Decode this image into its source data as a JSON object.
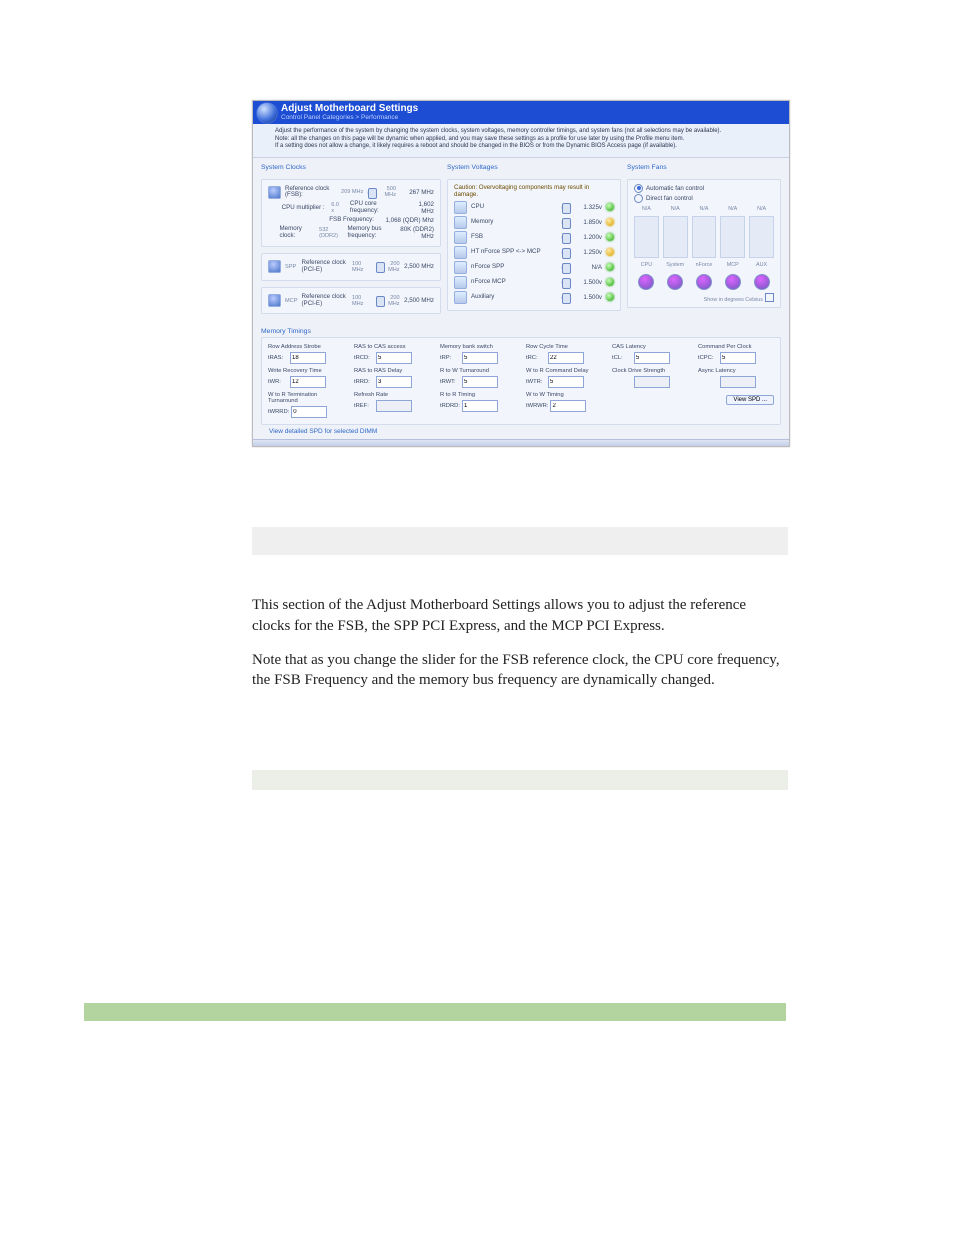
{
  "screenshot": {
    "title": "Adjust Motherboard Settings",
    "breadcrumb": "Control Panel Categories  >  Performance",
    "desc_line1": "Adjust the performance of the system by changing the system clocks, system voltages, memory controller timings, and system fans (not all selections may be available).",
    "desc_line2": "Note: all the changes on this page will be dynamic when applied, and you may save these settings as a profile for use later by using the Profile menu item.",
    "desc_line3": "If a setting does not allow a change, it likely requires a reboot and should be changed in the BIOS or from the Dynamic BIOS Access page (if available).",
    "clocks": {
      "heading": "System Clocks",
      "ref_fsb_label": "Reference clock (FSB):",
      "ref_fsb_val": "209\nMHz",
      "ref_fsb_max": "500\nMHz",
      "ref_fsb_mhz": "267 MHz",
      "cpu_mult_label": "CPU multiplier :",
      "cpu_mult_val": "6.0 x",
      "cpu_core_label": "CPU core frequency:",
      "cpu_core_val": "1,602 MHz",
      "fsb_freq_label": "FSB Frequency:",
      "fsb_freq_val": "1,068 (QDR) Mhz",
      "mem_clk_label": "Memory clock:",
      "mem_clk_val": "532 (DDR2)",
      "mem_bus_label": "Memory bus frequency:",
      "mem_bus_val": "80K (DDR2) MHz",
      "spp_label": "Reference clock (PCI-E)",
      "spp_tag": "SPP",
      "spp_val": "100\nMHz",
      "spp_max": "200\nMHz",
      "spp_mhz": "2,500 MHz",
      "mcp_label": "Reference clock (PCI-E)",
      "mcp_tag": "MCP",
      "mcp_val": "100\nMHz",
      "mcp_max": "200\nMHz",
      "mcp_mhz": "2,500 MHz"
    },
    "voltages": {
      "heading": "System Voltages",
      "caution": "Caution: Overvoltaging components may result in damage.",
      "items": [
        {
          "name": "CPU",
          "val": "1.325v",
          "led": "g"
        },
        {
          "name": "Memory",
          "val": "1.850v",
          "led": "y"
        },
        {
          "name": "FSB",
          "val": "1.200v",
          "led": "g"
        },
        {
          "name": "HT nForce SPP <-> MCP",
          "val": "1.250v",
          "led": "y"
        },
        {
          "name": "nForce SPP",
          "val": "N/A",
          "led": "g"
        },
        {
          "name": "nForce MCP",
          "val": "1.500v",
          "led": "g"
        },
        {
          "name": "Auxiliary",
          "val": "1.500v",
          "led": "g"
        }
      ]
    },
    "fans": {
      "heading": "System Fans",
      "opt_auto": "Automatic fan control",
      "opt_direct": "Direct fan control",
      "cols": [
        "CPU",
        "System",
        "nForce",
        "MCP",
        "AUX"
      ],
      "na": "N/A",
      "foot": "Show in degrees Celsius"
    },
    "timings": {
      "heading": "Memory Timings",
      "cells": [
        {
          "title": "Row Address Strobe",
          "abbr": "tRAS:",
          "val": "18"
        },
        {
          "title": "RAS to CAS access",
          "abbr": "tRCD:",
          "val": "5"
        },
        {
          "title": "Memory bank switch",
          "abbr": "tRP:",
          "val": "5"
        },
        {
          "title": "Row Cycle Time",
          "abbr": "tRC:",
          "val": "22"
        },
        {
          "title": "CAS Latency",
          "abbr": "tCL:",
          "val": "5"
        },
        {
          "title": "Command Per Clock",
          "abbr": "tCPC:",
          "val": "5"
        },
        {
          "title": "Write Recovery Time",
          "abbr": "tWR:",
          "val": "12"
        },
        {
          "title": "RAS to RAS Delay",
          "abbr": "tRRD:",
          "val": "3"
        },
        {
          "title": "R to W Turnaround",
          "abbr": "tRWT:",
          "val": "5"
        },
        {
          "title": "W to R Command Delay",
          "abbr": "tWTR:",
          "val": "5"
        },
        {
          "title": "Clock Drive Strength",
          "abbr": "",
          "val": "",
          "ro": true
        },
        {
          "title": "Async Latency",
          "abbr": "",
          "val": "",
          "ro": true
        },
        {
          "title": "W to R Termination Turnaround",
          "abbr": "tWRRD:",
          "val": "0"
        },
        {
          "title": "Refresh Rate",
          "abbr": "tREF:",
          "val": "",
          "ro": true
        },
        {
          "title": "R to R Timing",
          "abbr": "tRDRD:",
          "val": "1"
        },
        {
          "title": "W to W Timing",
          "abbr": "tWRWR:",
          "val": "2"
        },
        {
          "title": "",
          "abbr": "",
          "val": "",
          "blank": true
        },
        {
          "title": "",
          "abbr": "",
          "val": "",
          "btn": "View SPD ..."
        }
      ],
      "link": "View detailed SPD for selected DIMM"
    }
  },
  "body": {
    "p1": "This section of the Adjust Motherboard Settings allows you to adjust the reference clocks for the FSB, the SPP PCI Express, and the MCP PCI Express.",
    "p2": "Note that as you change the slider for the FSB reference clock, the CPU core frequency, the FSB Frequency and the memory bus frequency are dynamically changed."
  }
}
